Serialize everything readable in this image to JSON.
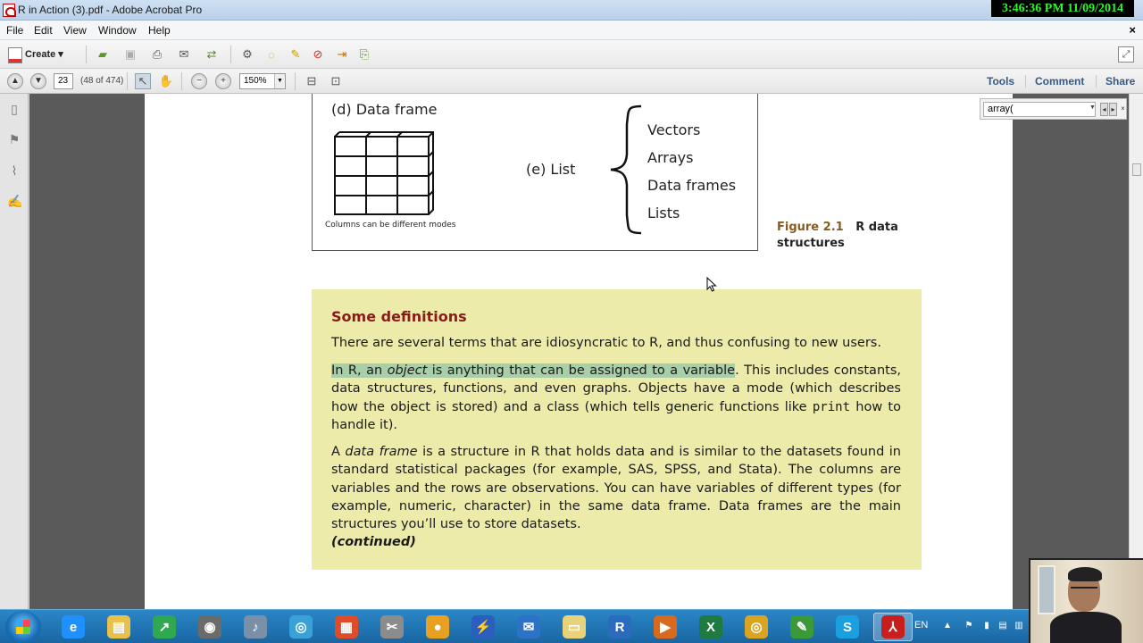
{
  "window": {
    "title": "R in Action (3).pdf - Adobe Acrobat Pro",
    "clock": "3:46:36 PM 11/09/2014"
  },
  "menu": {
    "items": [
      "File",
      "Edit",
      "View",
      "Window",
      "Help"
    ],
    "close_glyph": "×"
  },
  "toolbar": {
    "create_label": "Create",
    "page_number": "23",
    "page_count": "(48 of 474)",
    "zoom": "150%",
    "tools_label": "Tools",
    "comment_label": "Comment",
    "share_label": "Share"
  },
  "find": {
    "value": "array("
  },
  "figure": {
    "d_label": "(d) Data frame",
    "d_caption": "Columns can be different modes",
    "e_label": "(e) List",
    "list_items": [
      "Vectors",
      "Arrays",
      "Data frames",
      "Lists"
    ],
    "number": "Figure 2.1",
    "title_line1": "R data",
    "title_line2": "structures"
  },
  "definitions": {
    "heading": "Some definitions",
    "p1": "There are several terms that are idiosyncratic to R, and thus confusing to new users.",
    "p2_hl_a": "In R, an ",
    "p2_hl_em": "object",
    "p2_hl_b": " is anything that can be assigned to a variable",
    "p2_rest_a": ". This includes constants, data structures, functions, and even graphs. Objects have a mode (which describes how the object is stored) and a class (which tells generic functions like ",
    "p2_code": "print",
    "p2_rest_b": " how to handle it).",
    "p3_a": "A ",
    "p3_em": "data frame",
    "p3_b": " is a structure in R that holds data and is similar to the datasets found in standard statistical packages (for example, SAS, SPSS, and Stata). The columns are variables and the rows are observations. You can have variables of different types (for example, numeric, character) in the same data frame. Data frames are the main structures you’ll use to store datasets.",
    "continued": "(continued)"
  },
  "taskbar": {
    "language": "EN",
    "apps": [
      {
        "name": "internet-explorer",
        "glyph": "e",
        "color": "#1e90ff"
      },
      {
        "name": "file-explorer",
        "glyph": "▤",
        "color": "#e8c04a"
      },
      {
        "name": "stock-chart-app",
        "glyph": "↗",
        "color": "#2fa84f"
      },
      {
        "name": "wifi-app",
        "glyph": "◉",
        "color": "#6b6b6b"
      },
      {
        "name": "audio-app",
        "glyph": "♪",
        "color": "#7a8fa8"
      },
      {
        "name": "media-app",
        "glyph": "◎",
        "color": "#3aa0d8"
      },
      {
        "name": "apps-grid",
        "glyph": "▦",
        "color": "#e04b2a"
      },
      {
        "name": "snipping-tool",
        "glyph": "✂",
        "color": "#8c8c8c"
      },
      {
        "name": "circle-app",
        "glyph": "●",
        "color": "#e8a020"
      },
      {
        "name": "flow-app",
        "glyph": "⚡",
        "color": "#2a5fc0"
      },
      {
        "name": "outlook-app",
        "glyph": "✉",
        "color": "#2d72c4"
      },
      {
        "name": "folder-app",
        "glyph": "▭",
        "color": "#e8d27a"
      },
      {
        "name": "r-app",
        "glyph": "R",
        "color": "#2a6bbd"
      },
      {
        "name": "media-player-app",
        "glyph": "▶",
        "color": "#d86a20"
      },
      {
        "name": "excel-app",
        "glyph": "X",
        "color": "#1f7a3f"
      },
      {
        "name": "chrome-app",
        "glyph": "◎",
        "color": "#d9a520"
      },
      {
        "name": "photo-app",
        "glyph": "✎",
        "color": "#3a9a3a"
      },
      {
        "name": "skype-app",
        "glyph": "S",
        "color": "#1aa0e0"
      },
      {
        "name": "acrobat-app",
        "glyph": "⅄",
        "color": "#c81e1e"
      }
    ]
  }
}
